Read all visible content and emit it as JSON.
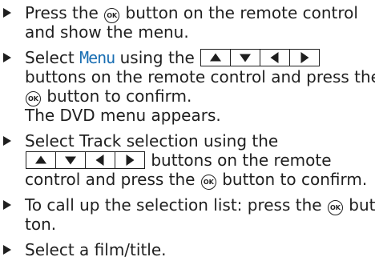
{
  "steps": [
    {
      "lines": [
        {
          "a": "Press the",
          "b": "button on the remote control"
        },
        {
          "a": "and show the menu."
        }
      ]
    },
    {
      "lines": [
        {
          "a": "Select",
          "menu": "Menu",
          "b": "using the"
        },
        {
          "a": "buttons on the remote control and press the"
        },
        {
          "b": "button to confirm."
        },
        {
          "a": "The DVD menu appears."
        }
      ]
    },
    {
      "lines": [
        {
          "a": "Select Track selection using the"
        },
        {
          "b": "buttons on the remote"
        },
        {
          "a": "control and press the",
          "b": "button to confirm."
        }
      ]
    },
    {
      "lines": [
        {
          "a": "To call up the selection list: press the",
          "b": "but-"
        },
        {
          "a": "ton."
        }
      ]
    },
    {
      "lines": [
        {
          "a": "Select a film/title."
        }
      ]
    }
  ],
  "ok_label": "OK",
  "icons": {
    "bullet": "triangle-right-bullet-icon",
    "ok": "ok-button-icon",
    "nav": [
      "arrow-up-icon",
      "arrow-down-icon",
      "arrow-left-icon",
      "arrow-right-icon"
    ]
  },
  "colors": {
    "text": "#1f1f1f",
    "menu_highlight": "#1a6fb3"
  }
}
